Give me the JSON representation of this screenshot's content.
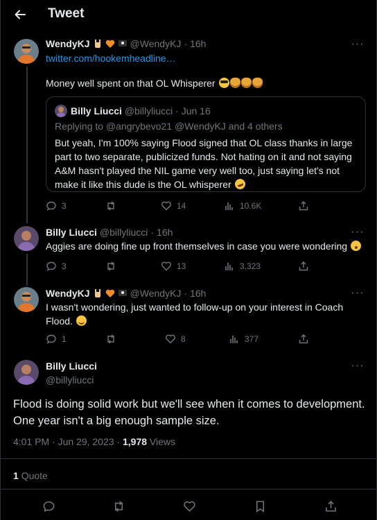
{
  "header": {
    "title": "Tweet"
  },
  "tweets": [
    {
      "name": "WendyKJ",
      "handle": "@WendyKJ",
      "time": "16h",
      "link": "twitter.com/hookemheadline…",
      "text": "Money well spent on that OL Whisperer",
      "quote": {
        "name": "Billy Liucci",
        "handle": "@billyliucci",
        "time": "Jun 16",
        "replying_prefix": "Replying to",
        "replying_to": "@angrybevo21 @WendyKJ and 4 others",
        "text": "But yeah, I'm 100% saying Flood signed that OL class thanks in large part to two separate, publicized funds. Not hating on it and not saying A&M hasn't played the NIL game very well too, just saying let's not make it like this dude is the OL whisperer"
      },
      "replies": "3",
      "likes": "14",
      "views": "10.6K"
    },
    {
      "name": "Billy Liucci",
      "handle": "@billyliucci",
      "time": "16h",
      "text": "Aggies are doing fine up front themselves in case you were wondering",
      "replies": "3",
      "likes": "13",
      "views": "3,323"
    },
    {
      "name": "WendyKJ",
      "handle": "@WendyKJ",
      "time": "16h",
      "text": "I wasn't wondering, just wanted to follow-up on your interest in Coach Flood.",
      "replies": "1",
      "likes": "8",
      "views": "377"
    }
  ],
  "main_tweet": {
    "name": "Billy Liucci",
    "handle": "@billyliucci",
    "text": "Flood is doing solid work but we'll see when it comes to development. One year isn't a big enough sample size.",
    "timestamp": "4:01 PM · Jun 29, 2023 ·",
    "views_count": "1,978",
    "views_label": "Views",
    "quote_count": "1",
    "quote_label": "Quote"
  },
  "colors": {
    "accent": "#1d9bf0",
    "muted": "#71767b",
    "text": "#e7e9ea",
    "border": "#2f3336"
  }
}
